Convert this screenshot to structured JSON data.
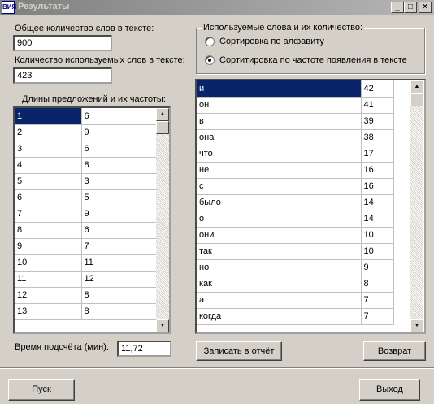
{
  "window": {
    "title": "Результаты",
    "icon_text": "ВИЯ",
    "minimize_glyph": "_",
    "maximize_glyph": "□",
    "close_glyph": "×"
  },
  "stats": {
    "total_words_label": "Общее количество слов в тексте:",
    "total_words_value": "900",
    "used_words_label": "Количество используемых слов в тексте:",
    "used_words_value": "423"
  },
  "lengths": {
    "label": "Длины предложений и их частоты:",
    "rows": [
      [
        "1",
        "6"
      ],
      [
        "2",
        "9"
      ],
      [
        "3",
        "6"
      ],
      [
        "4",
        "8"
      ],
      [
        "5",
        "3"
      ],
      [
        "6",
        "5"
      ],
      [
        "7",
        "9"
      ],
      [
        "8",
        "6"
      ],
      [
        "9",
        "7"
      ],
      [
        "10",
        "11"
      ],
      [
        "11",
        "12"
      ],
      [
        "12",
        "8"
      ],
      [
        "13",
        "8"
      ]
    ]
  },
  "sort_group": {
    "caption": "Используемые слова и их количество:",
    "option_alpha": "Сортировка по алфавиту",
    "option_freq": "Сортитировка по частоте появления в тексте",
    "selected": "freq"
  },
  "words": {
    "rows": [
      [
        "и",
        "42"
      ],
      [
        "он",
        "41"
      ],
      [
        "в",
        "39"
      ],
      [
        "она",
        "38"
      ],
      [
        "что",
        "17"
      ],
      [
        "не",
        "16"
      ],
      [
        "с",
        "16"
      ],
      [
        "было",
        "14"
      ],
      [
        "о",
        "14"
      ],
      [
        "они",
        "10"
      ],
      [
        "так",
        "10"
      ],
      [
        "но",
        "9"
      ],
      [
        "как",
        "8"
      ],
      [
        "а",
        "7"
      ],
      [
        "когда",
        "7"
      ]
    ]
  },
  "timing": {
    "label": "Время подсчёта (мин):",
    "value": "11,72"
  },
  "buttons": {
    "write_report": "Записать в отчёт",
    "back": "Возврат",
    "start": "Пуск",
    "exit": "Выход"
  },
  "icons": {
    "scroll_up": "▲",
    "scroll_down": "▼"
  },
  "colors": {
    "selection": "#0a246a",
    "face": "#d4d0c8"
  }
}
